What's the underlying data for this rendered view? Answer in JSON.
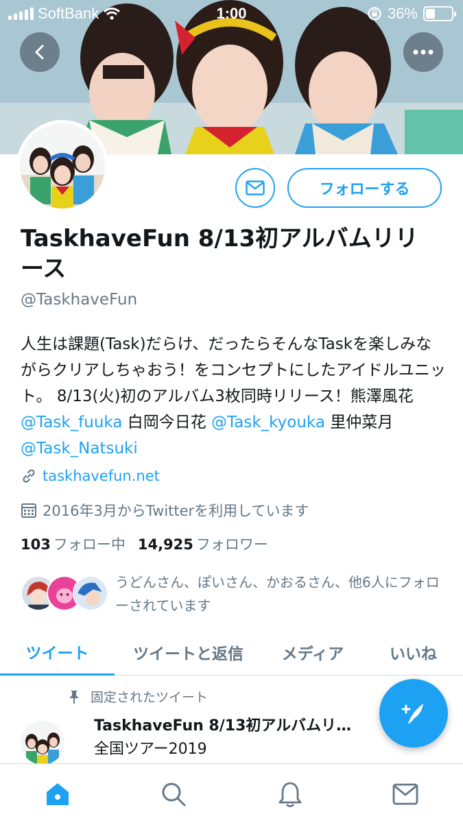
{
  "status_bar": {
    "carrier": "SoftBank",
    "time": "1:00",
    "battery_percent": "36%",
    "battery_level": 0.36
  },
  "profile": {
    "name": "TaskhaveFun 8/13初アルバムリリース",
    "handle": "@TaskhaveFun",
    "follow_label": "フォローする",
    "bio": {
      "part1": "人生は課題(Task)だらけ、だったらそんなTaskを楽しみながらクリアしちゃおう！をコンセプトにしたアイドルユニット。 8/13(火)初のアルバム3枚同時リリース！熊澤風花",
      "mention1": "@Task_fuuka",
      "part2": " 白岡今日花 ",
      "mention2": "@Task_kyouka",
      "part3": " 里仲菜月",
      "mention3": "@Task_Natsuki"
    },
    "website": "taskhavefun.net",
    "joined": "2016年3月からTwitterを利用しています",
    "following_count": "103",
    "following_label": "フォロー中",
    "followers_count": "14,925",
    "followers_label": "フォロワー",
    "followed_by_text": "うどんさん、ぽいさん、かおるさん、他6人にフォローされています"
  },
  "tabs": [
    "ツイート",
    "ツイートと返信",
    "メディア",
    "いいね"
  ],
  "pinned_tweet": {
    "label": "固定されたツイート",
    "title": "TaskhaveFun 8/13初アルバムリ…",
    "text": "全国ツアー2019"
  },
  "colors": {
    "accent": "#1da1f2",
    "secondary_text": "#657786"
  },
  "icons": {
    "back": "back-icon",
    "more": "more-icon",
    "message": "mail-icon",
    "link": "link-icon",
    "calendar": "calendar-icon",
    "pin": "pin-icon",
    "compose": "compose-icon",
    "nav": [
      "home-icon",
      "search-icon",
      "bell-icon",
      "mail-icon"
    ]
  }
}
